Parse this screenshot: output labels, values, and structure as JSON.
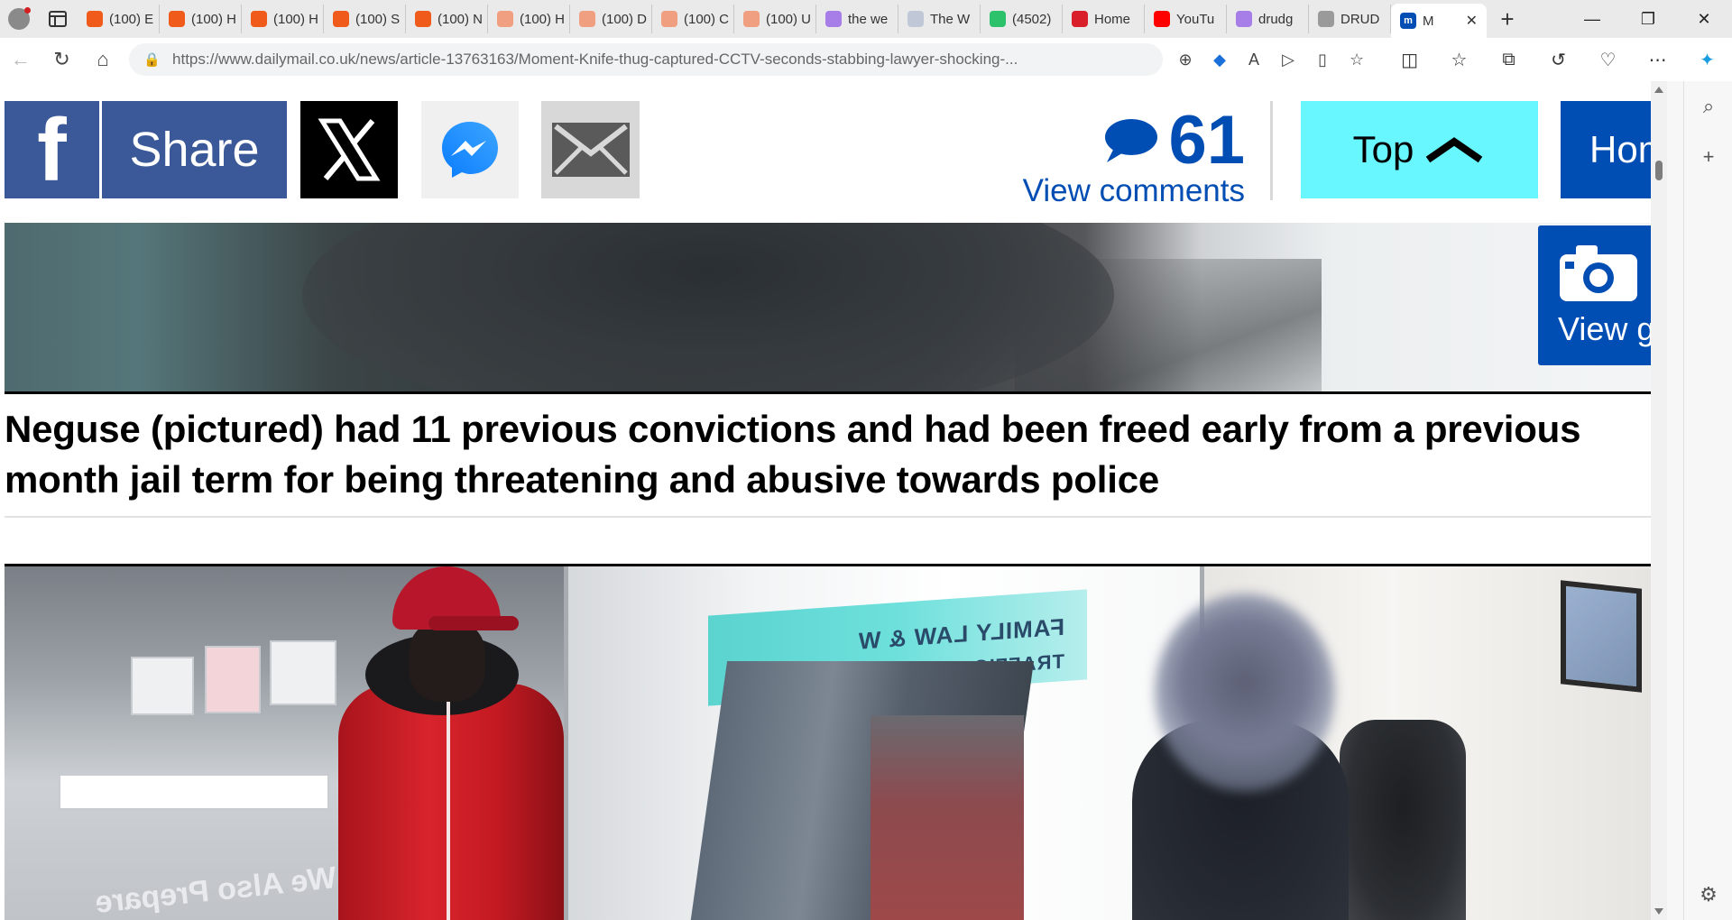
{
  "browser": {
    "tabs": [
      {
        "title": "(100) E",
        "favicon_color": "#f05a1a"
      },
      {
        "title": "(100) H",
        "favicon_color": "#f05a1a"
      },
      {
        "title": "(100) H",
        "favicon_color": "#f05a1a"
      },
      {
        "title": "(100) S",
        "favicon_color": "#f05a1a"
      },
      {
        "title": "(100) N",
        "favicon_color": "#f05a1a"
      },
      {
        "title": "(100) H",
        "favicon_color": "#f0a080"
      },
      {
        "title": "(100) D",
        "favicon_color": "#f0a080"
      },
      {
        "title": "(100) C",
        "favicon_color": "#f0a080"
      },
      {
        "title": "(100) U",
        "favicon_color": "#f0a080"
      },
      {
        "title": "the we",
        "favicon_color": "#a77de8"
      },
      {
        "title": "The W",
        "favicon_color": "#c0c8d8"
      },
      {
        "title": "(4502)",
        "favicon_color": "#2cc26b"
      },
      {
        "title": "Home",
        "favicon_color": "#d9202a"
      },
      {
        "title": "YouTu",
        "favicon_color": "#ff0000"
      },
      {
        "title": "drudg",
        "favicon_color": "#a77de8"
      },
      {
        "title": "DRUD",
        "favicon_color": "#9a9a9a"
      }
    ],
    "active_tab": {
      "title": "M",
      "favicon_letter": "m",
      "favicon_color": "#004db3"
    },
    "url_domain": "https://www.dailymail.co.uk",
    "url_path": "/news/article-13763163/Moment-Knife-thug-captured-CCTV-seconds-stabbing-lawyer-shocking-..."
  },
  "sharebar": {
    "facebook_label": "Share",
    "comment_count": "61",
    "view_comments": "View comments",
    "top_label": "Top",
    "home_label": "Hom",
    "colors": {
      "facebook": "#3b5998",
      "accent": "#004db3",
      "top": "#68f6ff"
    }
  },
  "gallery": {
    "label": "View g"
  },
  "caption": "Neguse (pictured) had 11 previous convictions and had been freed early from a previous month jail term for being threatening and abusive towards police",
  "cctv": {
    "sign_line1": "FAMILY LAW & W",
    "sign_line2": "TRAFFIC OFFENCE",
    "counter_text": "We Also Prepare"
  }
}
